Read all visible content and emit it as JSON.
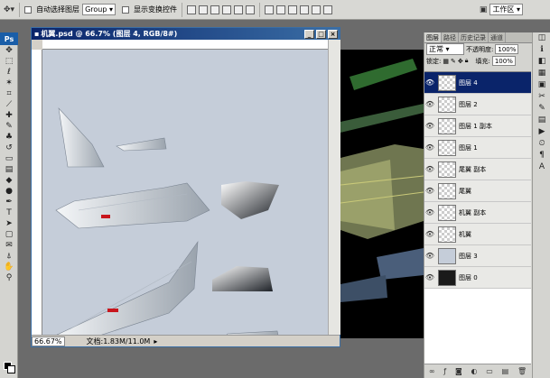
{
  "options_bar": {
    "auto_select_label": "自动选择图层",
    "group_value": "Group",
    "show_transform_label": "显示变换控件",
    "workspace_label": "工作区 ▾"
  },
  "document": {
    "title": "机翼.psd @ 66.7% (图层 4, RGB/8#)",
    "zoom": "66.67%",
    "doc_info": "文档:1.83M/11.0M"
  },
  "toolbox": {
    "logo": "Ps"
  },
  "panel": {
    "tabs": [
      "图层",
      "路径",
      "历史记录",
      "通道"
    ],
    "blend_mode": "正常",
    "opacity_label": "不透明度:",
    "opacity_value": "100%",
    "lock_label": "锁定:",
    "fill_label": "填充:",
    "fill_value": "100%",
    "layers": [
      {
        "name": "图层 4",
        "selected": true
      },
      {
        "name": "图层 2",
        "selected": false
      },
      {
        "name": "图层 1 副本",
        "selected": false
      },
      {
        "name": "图层 1",
        "selected": false
      },
      {
        "name": "尾翼 副本",
        "selected": false
      },
      {
        "name": "尾翼",
        "selected": false
      },
      {
        "name": "机翼 副本",
        "selected": false
      },
      {
        "name": "机翼",
        "selected": false
      },
      {
        "name": "图层 3",
        "selected": false
      },
      {
        "name": "图层 0",
        "selected": false
      }
    ]
  },
  "colors": {
    "title_bar": "#0a246a",
    "canvas": "#c5cdd9",
    "selection": "#0a246a",
    "foreground": "#000000",
    "background": "#ffffff"
  }
}
